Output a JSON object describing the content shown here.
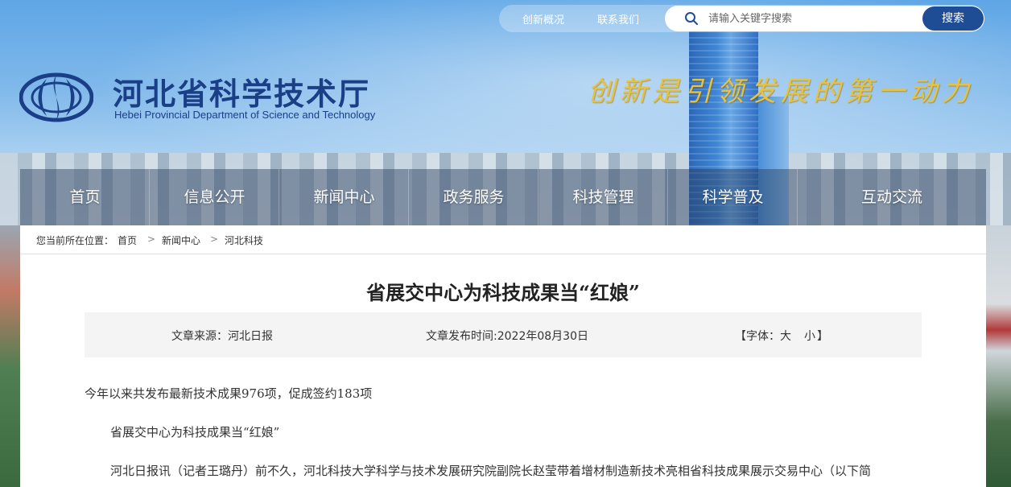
{
  "top_links": {
    "innovation_overview": "创新概况",
    "contact_us": "联系我们"
  },
  "search": {
    "placeholder": "请输入关键字搜索",
    "button_label": "搜索"
  },
  "brand": {
    "name_cn": "河北省科学技术厅",
    "name_en": "Hebei Provincial Department of Science and Technology",
    "slogan": "创新是引领发展的第一动力",
    "slogan_color": "#e8c23a"
  },
  "nav": {
    "items": [
      {
        "label": "首页"
      },
      {
        "label": "信息公开"
      },
      {
        "label": "新闻中心"
      },
      {
        "label": "政务服务"
      },
      {
        "label": "科技管理"
      },
      {
        "label": "科学普及"
      },
      {
        "label": "互动交流"
      }
    ]
  },
  "breadcrumb": {
    "prefix": "您当前所在位置：",
    "items": [
      "首页",
      "新闻中心",
      "河北科技"
    ],
    "separator": ">"
  },
  "article": {
    "title": "省展交中心为科技成果当“红娘”",
    "source": "文章来源：河北日报",
    "publish_time": "文章发布时间:2022年08月30日",
    "font_label": "【字体：",
    "font_large": "大",
    "font_small": "小",
    "font_close": "】",
    "paragraphs": [
      "今年以来共发布最新技术成果976项，促成签约183项",
      "省展交中心为科技成果当“红娘”",
      "河北日报讯（记者王璐丹）前不久，河北科技大学科学与技术发展研究院副院长赵莹带着增材制造新技术亮相省科技成果展示交易中心（以下简"
    ]
  },
  "colors": {
    "brand_blue": "#1a3f86",
    "button_blue": "#1e4d95"
  }
}
